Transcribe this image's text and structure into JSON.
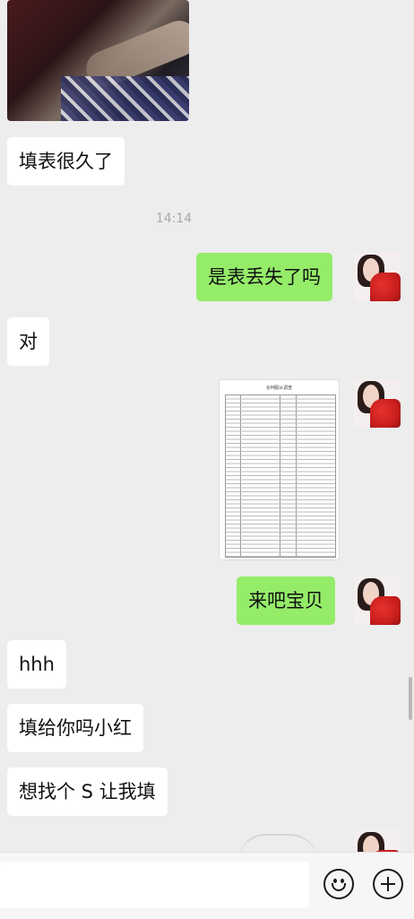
{
  "messages": {
    "m1": "填表很久了",
    "m2": "是表丢失了吗",
    "m3": "对",
    "m4": "来吧宝贝",
    "m5": "hhh",
    "m6": "填给你吗小红",
    "m7": "想找个 S 让我填"
  },
  "timestamp": "14:14",
  "document_title": "女M服从调查",
  "colors": {
    "sent_bubble": "#95ec69",
    "received_bubble": "#ffffff",
    "background": "#ededed"
  },
  "icons": {
    "emoji": "emoji-icon",
    "plus": "plus-icon"
  }
}
